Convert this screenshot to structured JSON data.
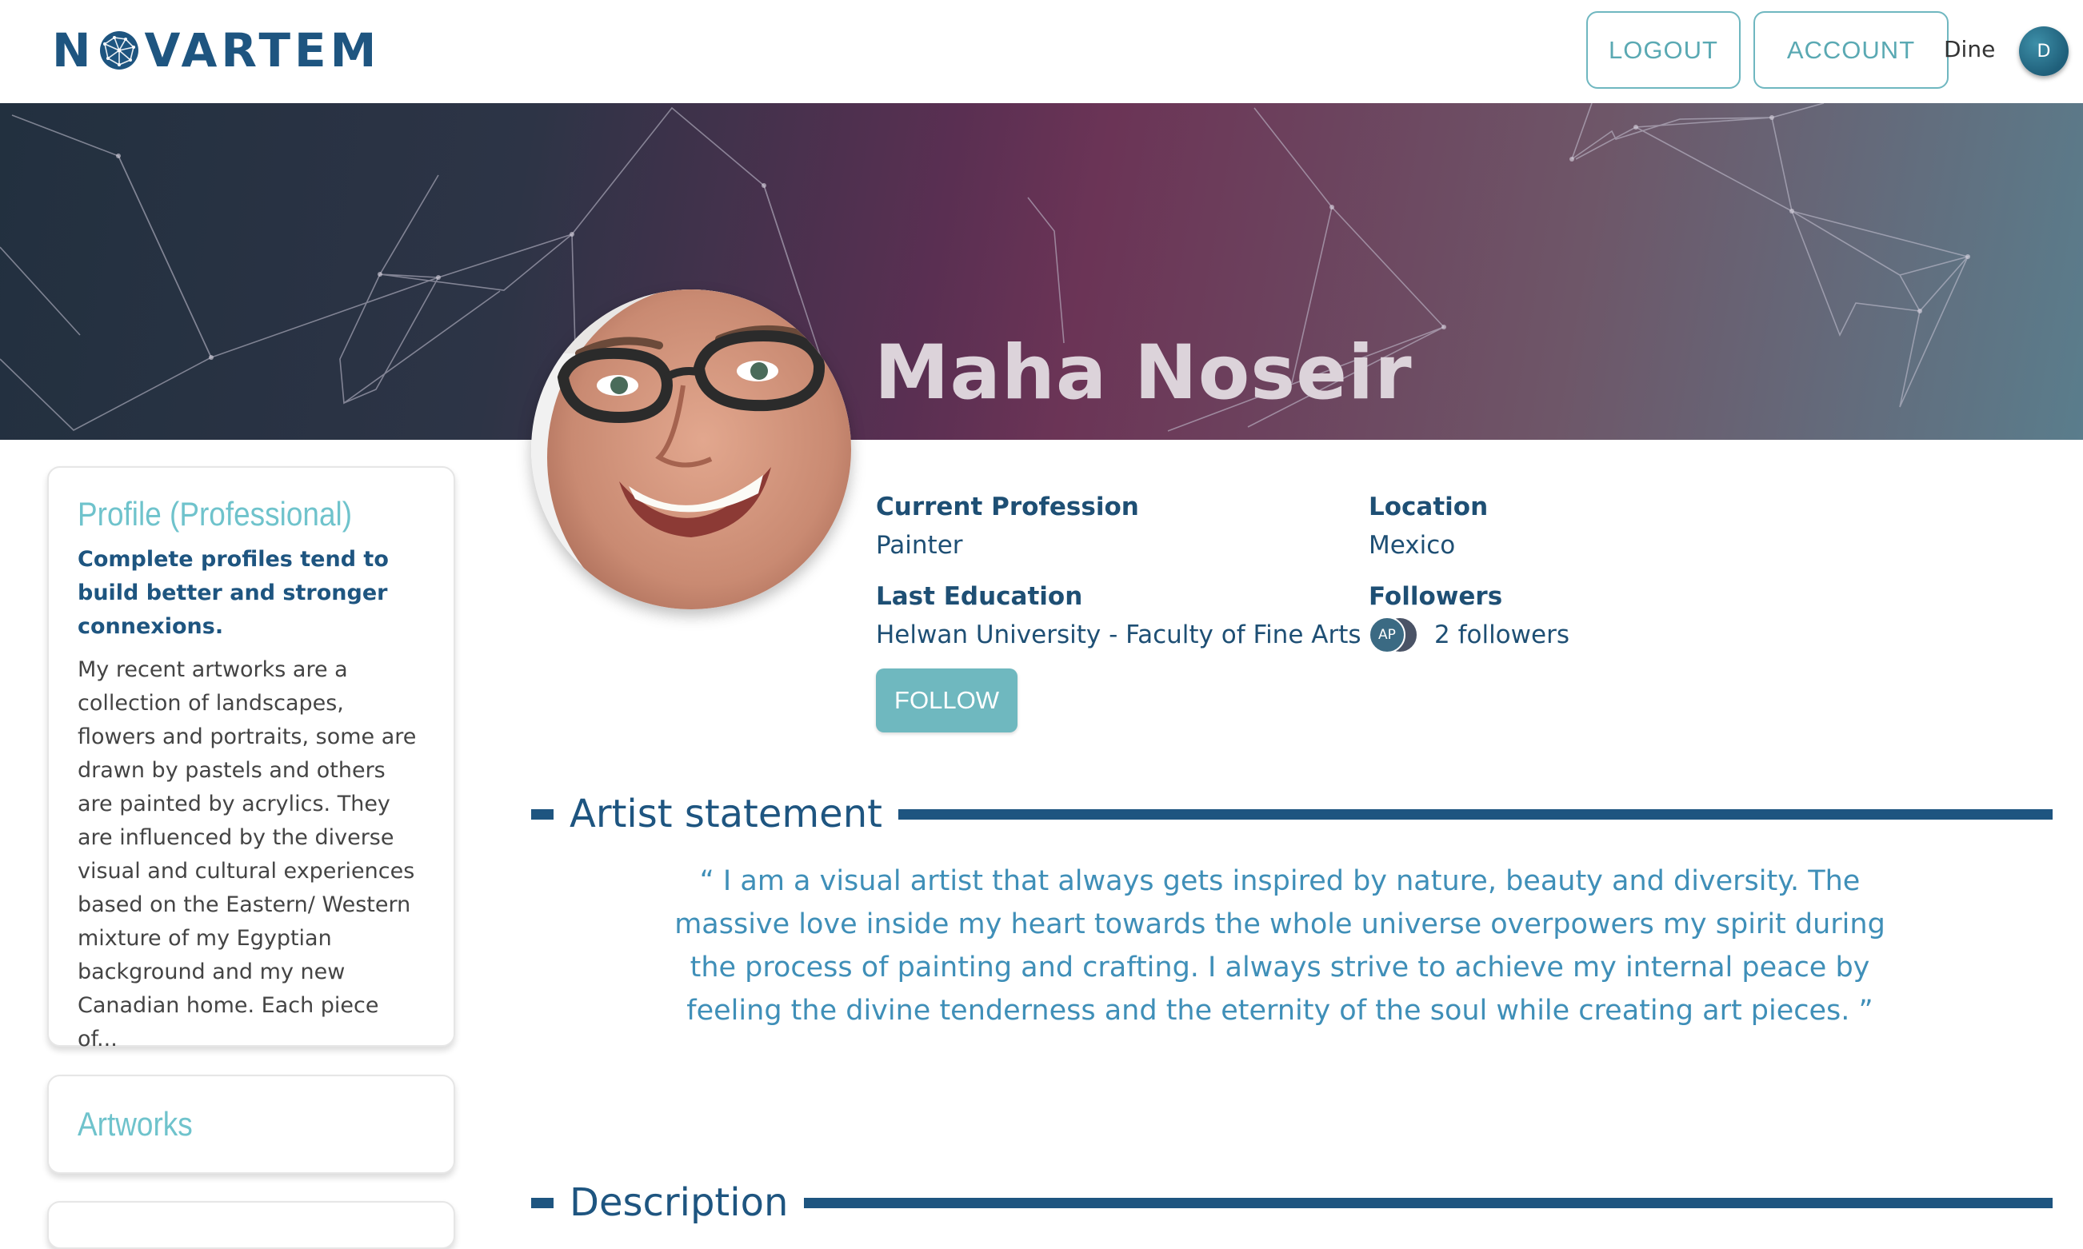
{
  "header": {
    "logo": "NOVARTEM",
    "logout_label": "LOGOUT",
    "account_label": "ACCOUNT",
    "user_name": "Dine",
    "user_initial": "D"
  },
  "profile": {
    "name": "Maha Noseir",
    "current_profession_label": "Current Profession",
    "current_profession": "Painter",
    "location_label": "Location",
    "location": "Mexico",
    "last_education_label": "Last Education",
    "last_education": "Helwan University - Faculty of Fine Arts",
    "followers_label": "Followers",
    "follower_avatar_initials": "AP",
    "followers_count": "2 followers",
    "follow_label": "FOLLOW"
  },
  "sidebar": {
    "profile_card": {
      "title": "Profile (Professional)",
      "subtitle": "Complete profiles tend to build better and stronger connexions.",
      "body": "My recent artworks are a collection of landscapes, flowers and portraits, some are drawn by pastels and others are painted by acrylics. They are influenced by the diverse visual and cultural experiences based on the Eastern/ Western mixture of my Egyptian background and my new Canadian home. Each piece of..."
    },
    "artworks_card": {
      "title": "Artworks"
    }
  },
  "sections": {
    "artist_statement_title": "Artist statement",
    "artist_statement_text": "“ I am a visual artist that always gets inspired by nature, beauty and diversity. The massive love inside my heart towards the whole universe overpowers my spirit during the process of painting and crafting. I always strive to achieve my internal peace by feeling the divine tenderness and the eternity of the soul while creating art pieces. ”",
    "description_title": "Description"
  },
  "colors": {
    "brand_navy": "#1e5580",
    "accent_teal": "#6fb8bf",
    "statement_blue": "#3f8fb8"
  },
  "icons": {
    "logo_globe": "globe-network-icon"
  }
}
